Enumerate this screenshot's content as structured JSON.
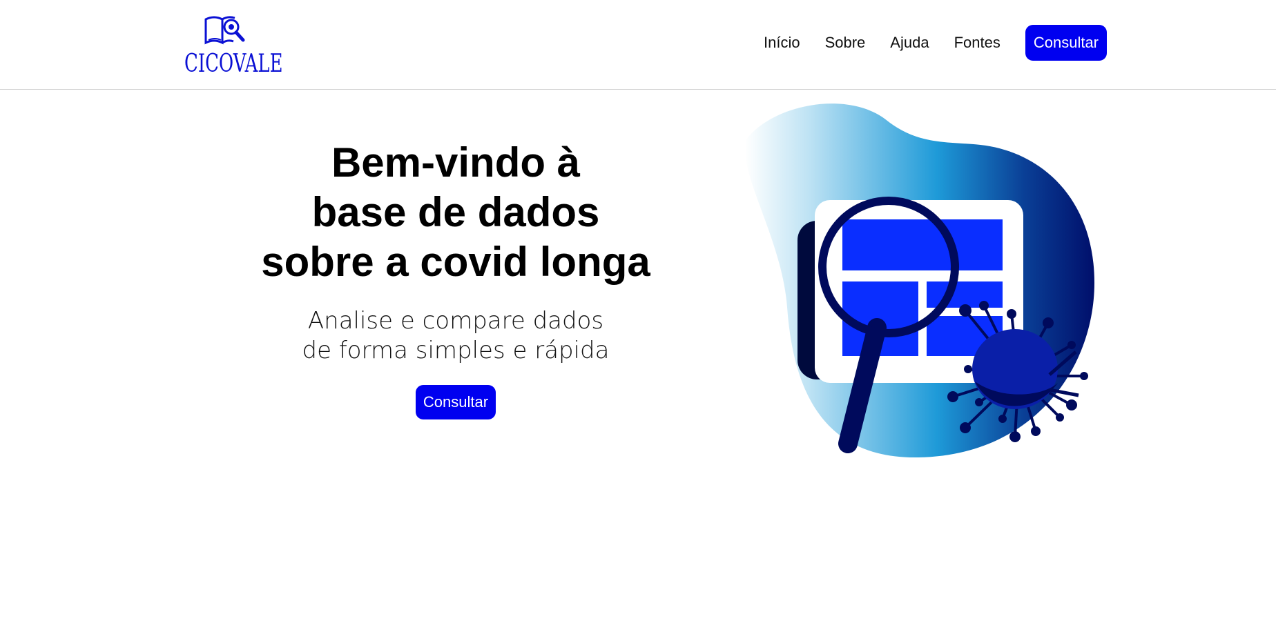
{
  "header": {
    "logo_text": "CICOVALE",
    "nav": [
      {
        "label": "Início"
      },
      {
        "label": "Sobre"
      },
      {
        "label": "Ajuda"
      },
      {
        "label": "Fontes"
      }
    ],
    "cta_label": "Consultar"
  },
  "hero": {
    "title_lines": [
      "Bem-vindo à",
      "base de dados",
      "sobre a covid longa"
    ],
    "subtitle_lines": [
      "Analise e compare dados",
      "de forma simples e rápida"
    ],
    "cta_label": "Consultar"
  },
  "colors": {
    "brand_blue": "#0000f0",
    "logo_blue": "#0a10d4",
    "navy": "#000a5c",
    "panel_blue": "#0a2eff"
  },
  "icons": [
    "book-magnifier-logo-icon",
    "magnifying-glass-icon",
    "virus-icon"
  ]
}
